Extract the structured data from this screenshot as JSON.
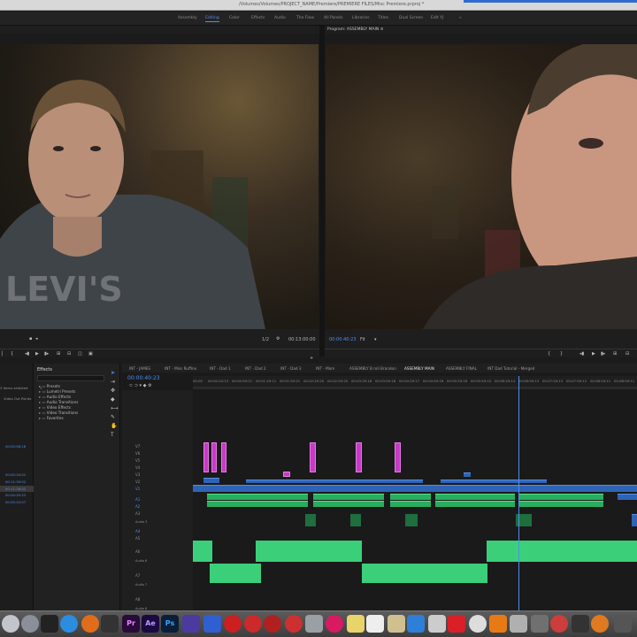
{
  "window": {
    "title": "/Volumes/Volumes/PROJECT_NAME/Premiere/PREMIERE FILES/Misc Premiere.prproj *"
  },
  "workspaces": [
    "Assembly",
    "Editing",
    "Color",
    "Effects",
    "Audio",
    "The Flow",
    "All Panels",
    "Libraries",
    "Titles",
    "Dual Screen",
    "Edit YJ"
  ],
  "workspace_active": "Editing",
  "program_panel": {
    "title": "Program: ASSEMBLY MAIN"
  },
  "source_footer": {
    "fraction": "1/2",
    "timecode": "00:13:00:00"
  },
  "program_footer": {
    "timecode": "00:00:40:23",
    "zoom": "Fit"
  },
  "effects_panel": {
    "title": "Effects",
    "items": [
      "Presets",
      "Lumetri Presets",
      "Audio Effects",
      "Audio Transitions",
      "Video Effects",
      "Video Transitions",
      "Favorites"
    ]
  },
  "left_strip": {
    "items_selected": "3 items selected",
    "label": "Video Out Points",
    "timecodes": [
      "00:00:56:16",
      "00:00:34:02",
      "00:11:39:02",
      "00:11:28:02",
      "00:00:20:23",
      "00:00:20:07"
    ]
  },
  "timeline": {
    "tabs": [
      "INT - JAMES",
      "INT - Miss Ruffino",
      "INT - Dad 1",
      "INT - Dad 2",
      "INT - Dad 3",
      "INT - Mom",
      "ASSEMBLY B roll Brandon",
      "ASSEMBLY MAIN",
      "ASSEMBLY FINAL",
      "INT Dad Tutorial - Merged"
    ],
    "active_tab": "ASSEMBLY MAIN",
    "timecode": "00:00:40:23",
    "ruler": [
      "00:00",
      "00:00:20:23",
      "00:00:59:21",
      "00:01:29:11",
      "00:01:59:21",
      "00:02:29:20",
      "00:02:59:20",
      "00:03:29:18",
      "00:03:59:18",
      "00:04:29:17",
      "00:04:59:16",
      "00:05:29:16",
      "00:05:59:15",
      "00:06:29:14",
      "00:06:59:13",
      "00:07:29:13",
      "00:07:59:12",
      "00:08:29:11",
      "00:08:59:11"
    ],
    "video_tracks": [
      "V7",
      "V6",
      "V5",
      "V4",
      "V3",
      "V2",
      "V1"
    ],
    "audio_tracks": [
      "A1",
      "A2",
      "A3",
      "A4",
      "A5",
      "A6",
      "A7",
      "A8"
    ],
    "audio_labels": [
      "Audio 3",
      "Audio 6",
      "Audio 7",
      "Audio 8"
    ]
  },
  "dock": [
    "Pr",
    "Ae",
    "Ps"
  ]
}
